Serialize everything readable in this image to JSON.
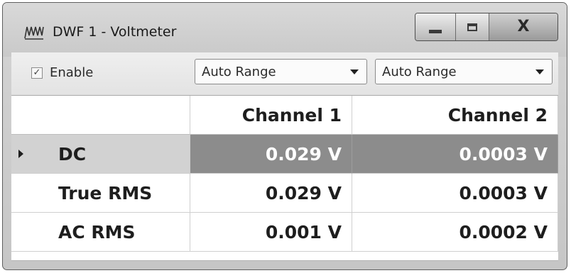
{
  "window": {
    "title": "DWF 1 - Voltmeter",
    "icon": "waveforms-app-icon",
    "controls": {
      "minimize": "minimize-icon",
      "maximize": "maximize-icon",
      "close": "X"
    }
  },
  "toolbar": {
    "enable": {
      "label": "Enable",
      "checked": true,
      "check_glyph": "✓"
    },
    "range1": {
      "value": "Auto Range"
    },
    "range2": {
      "value": "Auto Range"
    }
  },
  "table": {
    "columns": [
      "",
      "Channel 1",
      "Channel 2"
    ],
    "rows": [
      {
        "label": "DC",
        "ch1": "0.029 V",
        "ch2": "0.0003 V",
        "selected": true
      },
      {
        "label": "True RMS",
        "ch1": "0.029 V",
        "ch2": "0.0003 V",
        "selected": false
      },
      {
        "label": "AC RMS",
        "ch1": "0.001 V",
        "ch2": "0.0002 V",
        "selected": false
      }
    ]
  },
  "colors": {
    "selected_row_bg": "#8c8c8c",
    "selected_row_text": "#ffffff",
    "window_frame": "#c9c9c9"
  }
}
